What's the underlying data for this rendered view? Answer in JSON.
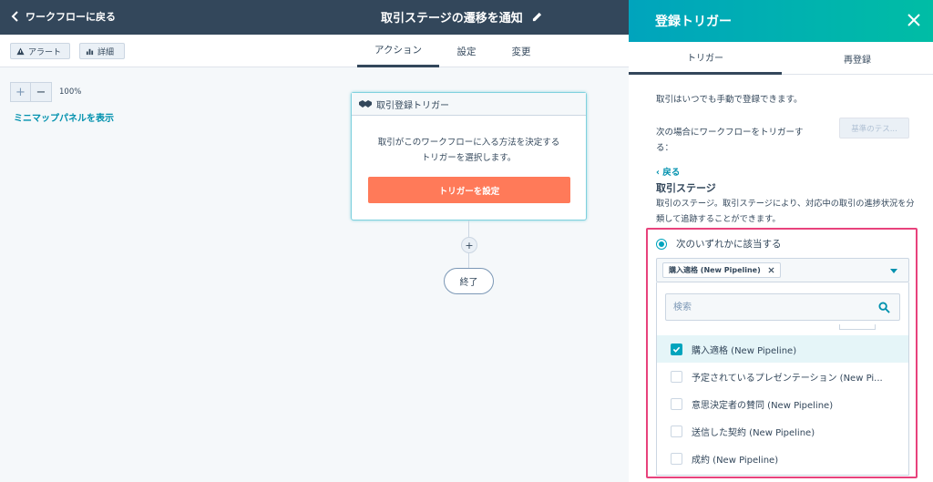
{
  "header": {
    "back_label": "ワークフローに戻る",
    "workflow_title": "取引ステージの遷移を通知"
  },
  "toolbar": {
    "alert_label": "アラート",
    "detail_label": "詳細",
    "tabs": [
      {
        "label": "アクション",
        "active": true
      },
      {
        "label": "設定",
        "active": false
      },
      {
        "label": "変更",
        "active": false
      }
    ]
  },
  "canvas": {
    "zoom_plus": "+",
    "zoom_minus": "−",
    "zoom_level": "100%",
    "minimap_label": "ミニマップパネルを表示",
    "trigger_card": {
      "title": "取引登録トリガー",
      "body_line1": "取引がこのワークフローに入る方法を決定する",
      "body_line2": "トリガーを選択します。",
      "button_label": "トリガーを設定"
    },
    "plus_node": "+",
    "end_label": "終了"
  },
  "panel": {
    "title": "登録トリガー",
    "tabs": [
      {
        "label": "トリガー",
        "active": true
      },
      {
        "label": "再登録",
        "active": false
      }
    ],
    "manual_note": "取引はいつでも手動で登録できます。",
    "trigger_when_line1": "次の場合にワークフローをトリガーす",
    "trigger_when_line2": "る：",
    "base_test_label": "基準のテス...",
    "back_label": "‹ 戻る",
    "section_title": "取引ステージ",
    "section_desc": "取引のステージ。取引ステージにより、対応中の取引の進捗状況を分類して追跡することができます。",
    "radio_label": "次のいずれかに該当する",
    "selected_chip": "購入適格 (New Pipeline)",
    "search_placeholder": "検索",
    "options": [
      {
        "label": "購入適格 (New Pipeline)",
        "checked": true
      },
      {
        "label": "予定されているプレゼンテーション (New Pi...",
        "checked": false
      },
      {
        "label": "意思決定者の賛同 (New Pipeline)",
        "checked": false
      },
      {
        "label": "送信した契約 (New Pipeline)",
        "checked": false
      },
      {
        "label": "成約 (New Pipeline)",
        "checked": false
      }
    ],
    "accent_color": "#00a4bd",
    "highlight_color": "#e8427c"
  }
}
